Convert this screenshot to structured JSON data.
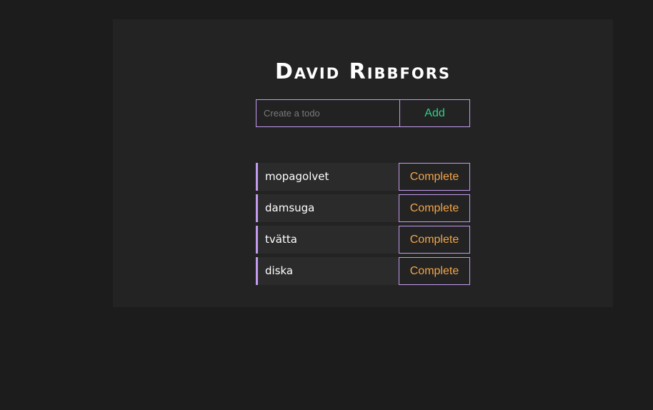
{
  "app": {
    "title": "David Ribbfors"
  },
  "form": {
    "input_value": "",
    "input_placeholder": "Create a todo",
    "add_label": "Add"
  },
  "todos": [
    {
      "text": "mopagolvet",
      "action_label": "Complete"
    },
    {
      "text": "damsuga",
      "action_label": "Complete"
    },
    {
      "text": "tvätta",
      "action_label": "Complete"
    },
    {
      "text": "diska",
      "action_label": "Complete"
    }
  ],
  "colors": {
    "background": "#1c1c1c",
    "panel": "#232323",
    "accent_border": "#c39bf0",
    "add_text": "#2ecf8a",
    "complete_text": "#f2a54a"
  }
}
